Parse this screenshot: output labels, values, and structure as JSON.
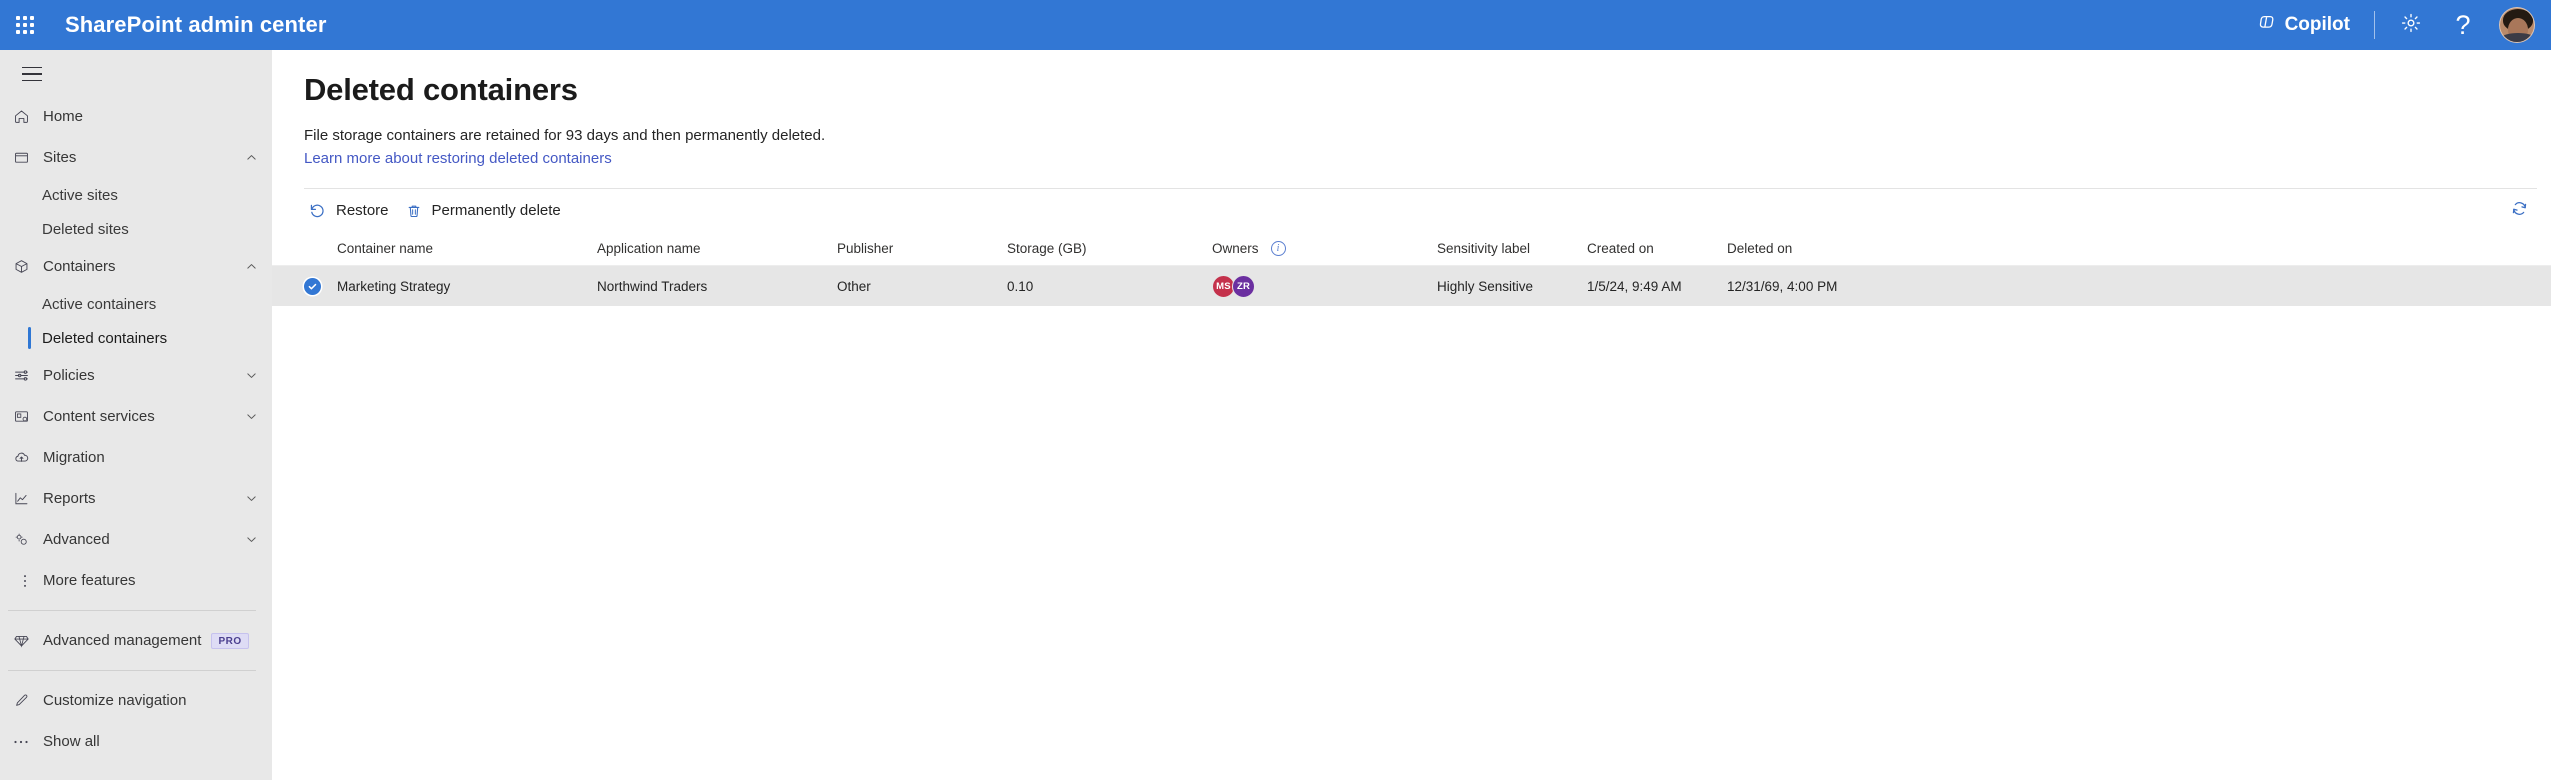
{
  "header": {
    "waffle_icon": "app-launcher-icon",
    "title": "SharePoint admin center",
    "copilot_label": "Copilot",
    "copilot_icon": "copilot-icon",
    "settings_icon": "gear-icon",
    "help_label": "?",
    "help_icon": "help-icon",
    "avatar_icon": "user-avatar",
    "background_color": "#3277D4"
  },
  "sidebar": {
    "hamburger_icon": "hamburger-menu-icon",
    "items": [
      {
        "label": "Home",
        "icon": "home-icon",
        "type": "item",
        "chevron": ""
      },
      {
        "label": "Sites",
        "icon": "sites-icon",
        "type": "item",
        "chevron": "up"
      },
      {
        "label": "Active sites",
        "type": "sub",
        "selected": false
      },
      {
        "label": "Deleted sites",
        "type": "sub",
        "selected": false
      },
      {
        "label": "Containers",
        "icon": "container-icon",
        "type": "item",
        "chevron": "up"
      },
      {
        "label": "Active containers",
        "type": "sub",
        "selected": false
      },
      {
        "label": "Deleted containers",
        "type": "sub",
        "selected": true
      },
      {
        "label": "Policies",
        "icon": "policies-icon",
        "type": "item",
        "chevron": "down"
      },
      {
        "label": "Content services",
        "icon": "content-services-icon",
        "type": "item",
        "chevron": "down"
      },
      {
        "label": "Migration",
        "icon": "migration-icon",
        "type": "item",
        "chevron": ""
      },
      {
        "label": "Reports",
        "icon": "reports-icon",
        "type": "item",
        "chevron": "down"
      },
      {
        "label": "Advanced",
        "icon": "advanced-icon",
        "type": "item",
        "chevron": "down"
      },
      {
        "label": "More features",
        "icon": "more-features-icon",
        "type": "item",
        "chevron": ""
      }
    ],
    "advanced_management": {
      "label": "Advanced management",
      "icon": "diamond-icon",
      "badge": "PRO",
      "badge_color": "#DEDCF5"
    },
    "footer_items": [
      {
        "label": "Customize navigation",
        "icon": "pencil-icon"
      },
      {
        "label": "Show all",
        "icon": "ellipsis-icon"
      }
    ],
    "selection_accent": "#2F77D4"
  },
  "main": {
    "page_title": "Deleted containers",
    "description": "File storage containers are retained for 93 days and then permanently deleted.",
    "learn_more_link": "Learn more about restoring deleted containers",
    "link_color": "#4458C4",
    "commands": [
      {
        "label": "Restore",
        "icon": "restore-undo-icon"
      },
      {
        "label": "Permanently delete",
        "icon": "trash-icon"
      }
    ],
    "refresh_icon": "refresh-icon",
    "table": {
      "columns": [
        "Container name",
        "Application name",
        "Publisher",
        "Storage (GB)",
        "Owners",
        "Sensitivity label",
        "Created on",
        "Deleted on"
      ],
      "owners_info_icon": "info-icon",
      "rows": [
        {
          "selected": true,
          "container_name": "Marketing Strategy",
          "application_name": "Northwind Traders",
          "publisher": "Other",
          "storage_gb": "0.10",
          "owners": [
            {
              "initials": "MS",
              "color": "#C4314B"
            },
            {
              "initials": "ZR",
              "color": "#6B2FA0"
            }
          ],
          "sensitivity_label": "Highly Sensitive",
          "created_on": "1/5/24, 9:49 AM",
          "deleted_on": "12/31/69, 4:00 PM"
        }
      ],
      "selected_row_color": "#E6E6E6"
    }
  }
}
